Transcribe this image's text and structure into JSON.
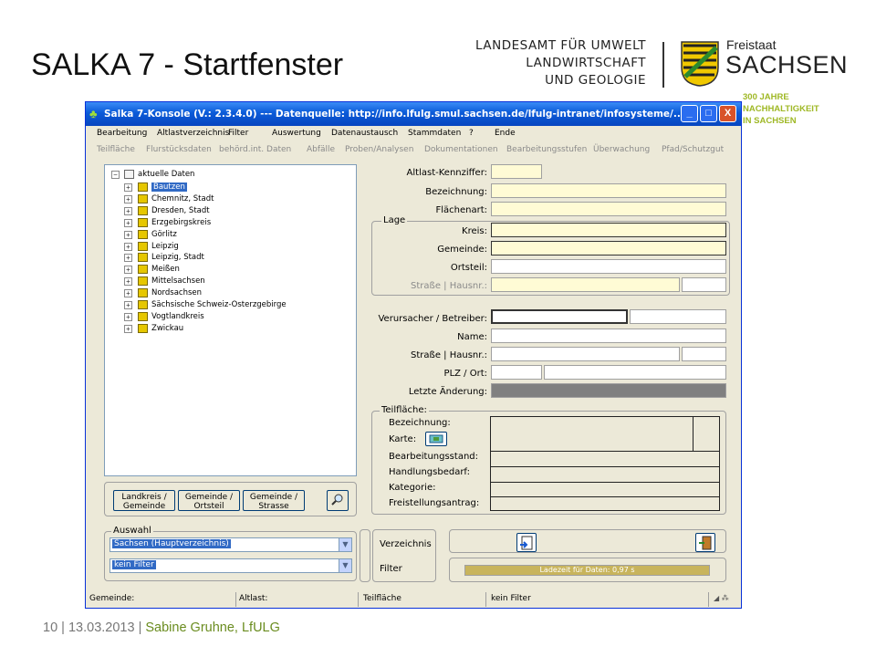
{
  "slide": {
    "title": "SALKA 7  - Startfenster",
    "lfulg_lines": [
      "LANDESAMT FÜR UMWELT",
      "LANDWIRTSCHAFT",
      "UND GEOLOGIE"
    ],
    "freistaat": "Freistaat",
    "sachsen": "SACHSEN",
    "anniversary": [
      "300 JAHRE",
      "NACHHALTIGKEIT",
      "IN SACHSEN"
    ],
    "footer": {
      "page": "10",
      "sep1": " | ",
      "date": "13.03.2013",
      "sep2": " | ",
      "author": "Sabine Gruhne, LfULG"
    }
  },
  "window": {
    "title": "Salka 7-Konsole (V.: 2.3.4.0)   ---   Datenquelle: http://info.lfulg.smul.sachsen.de/lfulg-intranet/infosysteme/...",
    "buttons": {
      "minimize": "_",
      "maximize": "□",
      "close": "X"
    },
    "menu": [
      "Bearbeitung",
      "Altlastverzeichnis",
      "Filter",
      "Auswertung",
      "Datenaustausch",
      "Stammdaten",
      "?",
      "Ende"
    ],
    "submenu": [
      "Teilfläche",
      "Flurstücksdaten",
      "behörd.int. Daten",
      "Abfälle",
      "Proben/Analysen",
      "Dokumentationen",
      "Bearbeitungsstufen",
      "Überwachung",
      "Pfad/Schutzgut"
    ]
  },
  "tree": {
    "root": "aktuelle Daten",
    "items": [
      "Bautzen",
      "Chemnitz, Stadt",
      "Dresden, Stadt",
      "Erzgebirgskreis",
      "Görlitz",
      "Leipzig",
      "Leipzig, Stadt",
      "Meißen",
      "Mittelsachsen",
      "Nordsachsen",
      "Sächsische Schweiz-Osterzgebirge",
      "Vogtlandkreis",
      "Zwickau"
    ],
    "selected": "Bautzen"
  },
  "form": {
    "altlast_kennziffer": "Altlast-Kennziffer:",
    "bezeichnung": "Bezeichnung:",
    "flaechenart": "Flächenart:",
    "lage_group": "Lage",
    "kreis": "Kreis:",
    "gemeinde": "Gemeinde:",
    "ortsteil": "Ortsteil:",
    "strasse_lage": "Straße | Hausnr.:",
    "verursacher": "Verursacher / Betreiber:",
    "name": "Name:",
    "strasse": "Straße | Hausnr.:",
    "plz": "PLZ / Ort:",
    "letzte_aenderung": "Letzte Änderung:",
    "teilflaeche_group": "Teilfläche:",
    "tf_bezeichnung": "Bezeichnung:",
    "tf_karte": "Karte:",
    "tf_bearbeitungsstand": "Bearbeitungsstand:",
    "tf_handlungsbedarf": "Handlungsbedarf:",
    "tf_kategorie": "Kategorie:",
    "tf_freistellung": "Freistellungsantrag:"
  },
  "nav_buttons": [
    [
      "Landkreis /",
      "Gemeinde"
    ],
    [
      "Gemeinde /",
      "Ortsteil"
    ],
    [
      "Gemeinde /",
      "Strasse"
    ]
  ],
  "auswahl": {
    "label": "Auswahl",
    "combo1": "Sachsen (Hauptverzeichnis)",
    "combo2": "kein Filter",
    "verzeichnis": "Verzeichnis",
    "filter": "Filter",
    "progress_text": "Ladezeit für Daten: 0,97 s",
    "progress_fraction": 1.0
  },
  "statusbar": [
    "Gemeinde:",
    "Altlast:",
    "Teilfläche",
    "kein Filter"
  ],
  "colors": {
    "titlebar": "#0a5ad8",
    "field_yellow": "#fffbd5",
    "progress": "#c8b45c",
    "accent_green": "#9fb825"
  }
}
